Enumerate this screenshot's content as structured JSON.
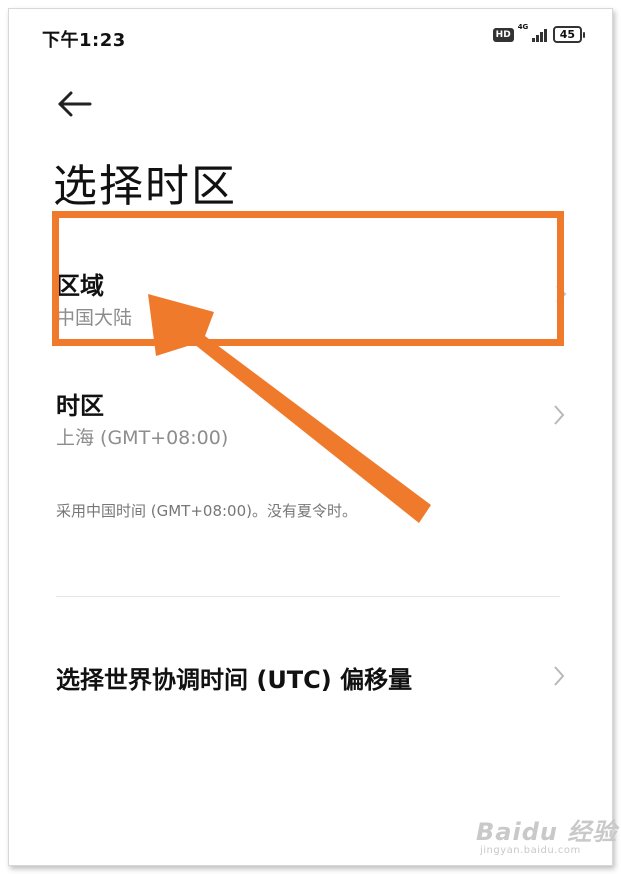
{
  "status_bar": {
    "time": "下午1:23",
    "hd_label": "HD",
    "network_label": "4G",
    "battery": "45"
  },
  "header": {
    "back_icon": "arrow-left-icon",
    "title": "选择时区"
  },
  "settings": {
    "region": {
      "label": "区域",
      "value": "中国大陆"
    },
    "timezone": {
      "label": "时区",
      "value": "上海 (GMT+08:00)"
    },
    "note": "采用中国时间 (GMT+08:00)。没有夏令时。",
    "utc_offset": {
      "label": "选择世界协调时间 (UTC) 偏移量"
    }
  },
  "annotation": {
    "highlight_color": "#f07a2c",
    "arrow_color": "#f07a2c"
  },
  "watermark": {
    "main": "Baidu 经验",
    "sub": "jingyan.baidu.com"
  }
}
